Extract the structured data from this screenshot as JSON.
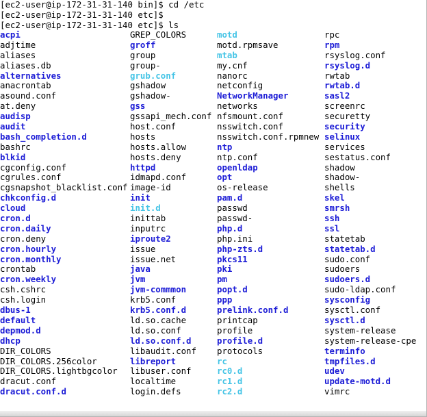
{
  "terminal": {
    "prompts": [
      "[ec2-user@ip-172-31-31-140 bin]$ cd /etc",
      "[ec2-user@ip-172-31-31-140 etc]$",
      "[ec2-user@ip-172-31-31-140 etc]$ ls"
    ],
    "colors": {
      "file": "#000000",
      "dir": "#1c1cd6",
      "link": "#44c4e6"
    },
    "columns": [
      [
        {
          "name": "acpi",
          "type": "dir"
        },
        {
          "name": "adjtime",
          "type": "file"
        },
        {
          "name": "aliases",
          "type": "file"
        },
        {
          "name": "aliases.db",
          "type": "file"
        },
        {
          "name": "alternatives",
          "type": "dir"
        },
        {
          "name": "anacrontab",
          "type": "file"
        },
        {
          "name": "asound.conf",
          "type": "file"
        },
        {
          "name": "at.deny",
          "type": "file"
        },
        {
          "name": "audisp",
          "type": "dir"
        },
        {
          "name": "audit",
          "type": "dir"
        },
        {
          "name": "bash_completion.d",
          "type": "dir"
        },
        {
          "name": "bashrc",
          "type": "file"
        },
        {
          "name": "blkid",
          "type": "dir"
        },
        {
          "name": "cgconfig.conf",
          "type": "file"
        },
        {
          "name": "cgrules.conf",
          "type": "file"
        },
        {
          "name": "cgsnapshot_blacklist.conf",
          "type": "file"
        },
        {
          "name": "chkconfig.d",
          "type": "dir"
        },
        {
          "name": "cloud",
          "type": "dir"
        },
        {
          "name": "cron.d",
          "type": "dir"
        },
        {
          "name": "cron.daily",
          "type": "dir"
        },
        {
          "name": "cron.deny",
          "type": "file"
        },
        {
          "name": "cron.hourly",
          "type": "dir"
        },
        {
          "name": "cron.monthly",
          "type": "dir"
        },
        {
          "name": "crontab",
          "type": "file"
        },
        {
          "name": "cron.weekly",
          "type": "dir"
        },
        {
          "name": "csh.cshrc",
          "type": "file"
        },
        {
          "name": "csh.login",
          "type": "file"
        },
        {
          "name": "dbus-1",
          "type": "dir"
        },
        {
          "name": "default",
          "type": "dir"
        },
        {
          "name": "depmod.d",
          "type": "dir"
        },
        {
          "name": "dhcp",
          "type": "dir"
        },
        {
          "name": "DIR_COLORS",
          "type": "file"
        },
        {
          "name": "DIR_COLORS.256color",
          "type": "file"
        },
        {
          "name": "DIR_COLORS.lightbgcolor",
          "type": "file"
        },
        {
          "name": "dracut.conf",
          "type": "file"
        },
        {
          "name": "dracut.conf.d",
          "type": "dir"
        }
      ],
      [
        {
          "name": "GREP_COLORS",
          "type": "file"
        },
        {
          "name": "groff",
          "type": "dir"
        },
        {
          "name": "group",
          "type": "file"
        },
        {
          "name": "group-",
          "type": "file"
        },
        {
          "name": "grub.conf",
          "type": "link"
        },
        {
          "name": "gshadow",
          "type": "file"
        },
        {
          "name": "gshadow-",
          "type": "file"
        },
        {
          "name": "gss",
          "type": "dir"
        },
        {
          "name": "gssapi_mech.conf",
          "type": "file"
        },
        {
          "name": "host.conf",
          "type": "file"
        },
        {
          "name": "hosts",
          "type": "file"
        },
        {
          "name": "hosts.allow",
          "type": "file"
        },
        {
          "name": "hosts.deny",
          "type": "file"
        },
        {
          "name": "httpd",
          "type": "dir"
        },
        {
          "name": "idmapd.conf",
          "type": "file"
        },
        {
          "name": "image-id",
          "type": "file"
        },
        {
          "name": "init",
          "type": "dir"
        },
        {
          "name": "init.d",
          "type": "link"
        },
        {
          "name": "inittab",
          "type": "file"
        },
        {
          "name": "inputrc",
          "type": "file"
        },
        {
          "name": "iproute2",
          "type": "dir"
        },
        {
          "name": "issue",
          "type": "file"
        },
        {
          "name": "issue.net",
          "type": "file"
        },
        {
          "name": "java",
          "type": "dir"
        },
        {
          "name": "jvm",
          "type": "dir"
        },
        {
          "name": "jvm-commmon",
          "type": "dir"
        },
        {
          "name": "krb5.conf",
          "type": "file"
        },
        {
          "name": "krb5.conf.d",
          "type": "dir"
        },
        {
          "name": "ld.so.cache",
          "type": "file"
        },
        {
          "name": "ld.so.conf",
          "type": "file"
        },
        {
          "name": "ld.so.conf.d",
          "type": "dir"
        },
        {
          "name": "libaudit.conf",
          "type": "file"
        },
        {
          "name": "libreport",
          "type": "dir"
        },
        {
          "name": "libuser.conf",
          "type": "file"
        },
        {
          "name": "localtime",
          "type": "file"
        },
        {
          "name": "login.defs",
          "type": "file"
        }
      ],
      [
        {
          "name": "motd",
          "type": "link"
        },
        {
          "name": "motd.rpmsave",
          "type": "file"
        },
        {
          "name": "mtab",
          "type": "link"
        },
        {
          "name": "my.cnf",
          "type": "file"
        },
        {
          "name": "nanorc",
          "type": "file"
        },
        {
          "name": "netconfig",
          "type": "file"
        },
        {
          "name": "NetworkManager",
          "type": "dir"
        },
        {
          "name": "networks",
          "type": "file"
        },
        {
          "name": "nfsmount.conf",
          "type": "file"
        },
        {
          "name": "nsswitch.conf",
          "type": "file"
        },
        {
          "name": "nsswitch.conf.rpmnew",
          "type": "file"
        },
        {
          "name": "ntp",
          "type": "dir"
        },
        {
          "name": "ntp.conf",
          "type": "file"
        },
        {
          "name": "openldap",
          "type": "dir"
        },
        {
          "name": "opt",
          "type": "dir"
        },
        {
          "name": "os-release",
          "type": "file"
        },
        {
          "name": "pam.d",
          "type": "dir"
        },
        {
          "name": "passwd",
          "type": "file"
        },
        {
          "name": "passwd-",
          "type": "file"
        },
        {
          "name": "php.d",
          "type": "dir"
        },
        {
          "name": "php.ini",
          "type": "file"
        },
        {
          "name": "php-zts.d",
          "type": "dir"
        },
        {
          "name": "pkcs11",
          "type": "dir"
        },
        {
          "name": "pki",
          "type": "dir"
        },
        {
          "name": "pm",
          "type": "dir"
        },
        {
          "name": "popt.d",
          "type": "dir"
        },
        {
          "name": "ppp",
          "type": "dir"
        },
        {
          "name": "prelink.conf.d",
          "type": "dir"
        },
        {
          "name": "printcap",
          "type": "file"
        },
        {
          "name": "profile",
          "type": "file"
        },
        {
          "name": "profile.d",
          "type": "dir"
        },
        {
          "name": "protocols",
          "type": "file"
        },
        {
          "name": "rc",
          "type": "link"
        },
        {
          "name": "rc0.d",
          "type": "link"
        },
        {
          "name": "rc1.d",
          "type": "link"
        },
        {
          "name": "rc2.d",
          "type": "link"
        }
      ],
      [
        {
          "name": "rpc",
          "type": "file"
        },
        {
          "name": "rpm",
          "type": "dir"
        },
        {
          "name": "rsyslog.conf",
          "type": "file"
        },
        {
          "name": "rsyslog.d",
          "type": "dir"
        },
        {
          "name": "rwtab",
          "type": "file"
        },
        {
          "name": "rwtab.d",
          "type": "dir"
        },
        {
          "name": "sasl2",
          "type": "dir"
        },
        {
          "name": "screenrc",
          "type": "file"
        },
        {
          "name": "securetty",
          "type": "file"
        },
        {
          "name": "security",
          "type": "dir"
        },
        {
          "name": "selinux",
          "type": "dir"
        },
        {
          "name": "services",
          "type": "file"
        },
        {
          "name": "sestatus.conf",
          "type": "file"
        },
        {
          "name": "shadow",
          "type": "file"
        },
        {
          "name": "shadow-",
          "type": "file"
        },
        {
          "name": "shells",
          "type": "file"
        },
        {
          "name": "skel",
          "type": "dir"
        },
        {
          "name": "smrsh",
          "type": "dir"
        },
        {
          "name": "ssh",
          "type": "dir"
        },
        {
          "name": "ssl",
          "type": "dir"
        },
        {
          "name": "statetab",
          "type": "file"
        },
        {
          "name": "statetab.d",
          "type": "dir"
        },
        {
          "name": "sudo.conf",
          "type": "file"
        },
        {
          "name": "sudoers",
          "type": "file"
        },
        {
          "name": "sudoers.d",
          "type": "dir"
        },
        {
          "name": "sudo-ldap.conf",
          "type": "file"
        },
        {
          "name": "sysconfig",
          "type": "dir"
        },
        {
          "name": "sysctl.conf",
          "type": "file"
        },
        {
          "name": "sysctl.d",
          "type": "dir"
        },
        {
          "name": "system-release",
          "type": "file"
        },
        {
          "name": "system-release-cpe",
          "type": "file"
        },
        {
          "name": "terminfo",
          "type": "dir"
        },
        {
          "name": "tmpfiles.d",
          "type": "dir"
        },
        {
          "name": "udev",
          "type": "dir"
        },
        {
          "name": "update-motd.d",
          "type": "dir"
        },
        {
          "name": "vimrc",
          "type": "file"
        }
      ]
    ]
  }
}
